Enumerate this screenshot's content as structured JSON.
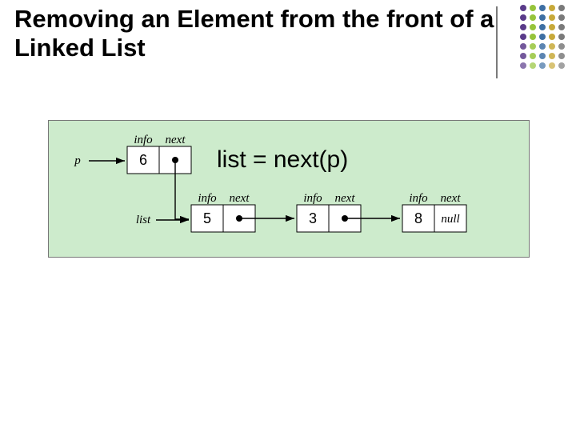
{
  "title": "Removing an Element from the front of a Linked List",
  "diagram": {
    "expression": "list = next(p)",
    "labels": {
      "p": "p",
      "list": "list",
      "info": "info",
      "next": "next",
      "null": "null"
    },
    "nodes": [
      {
        "value": "6",
        "has_next_ptr": true
      },
      {
        "value": "5",
        "has_next_ptr": true
      },
      {
        "value": "3",
        "has_next_ptr": true
      },
      {
        "value": "8",
        "has_next_ptr": false
      }
    ]
  },
  "decor": {
    "dot_colors": [
      "#5a3b8a",
      "#96c43b",
      "#3e6fa3",
      "#c7a93a",
      "#7a7a7a"
    ],
    "dot_rows": 7,
    "dot_cols": 5
  }
}
